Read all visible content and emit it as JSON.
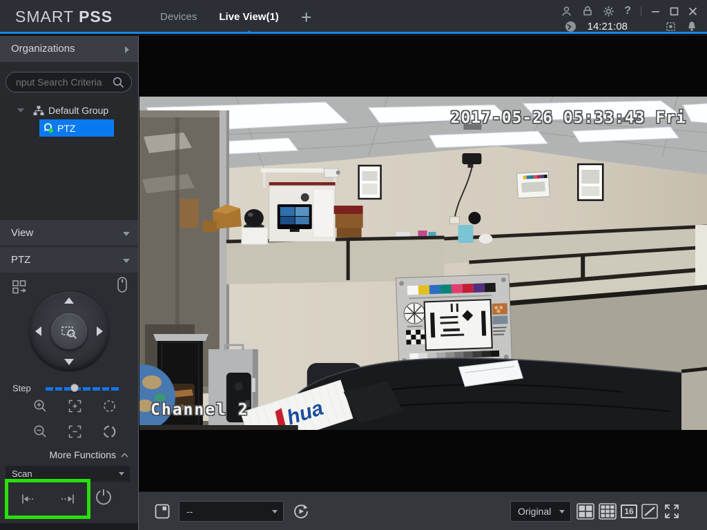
{
  "titlebar": {
    "brand_smart": "SMART",
    "brand_pss": "PSS",
    "tabs": [
      {
        "label": "Devices"
      },
      {
        "label": "Live View(1)"
      }
    ],
    "add_tab_label": "+",
    "help_label": "?",
    "time": "14:21:08"
  },
  "sidebar": {
    "organizations_label": "Organizations",
    "search_placeholder": "nput Search Criteria",
    "tree": {
      "group_label": "Default Group",
      "device_label": "PTZ"
    },
    "view_label": "View",
    "ptz_label": "PTZ",
    "step_label": "Step",
    "more_functions_label": "More Functions",
    "scan_label": "Scan"
  },
  "video": {
    "timestamp": "2017-05-26 05:33:43 Fri",
    "channel_label": "Channel 2",
    "box_logo": "hua"
  },
  "toolbar": {
    "stream_select_value": "--",
    "scale_select_value": "Original",
    "grid_16_label": "16"
  },
  "colors": {
    "accent_blue": "#1787e8",
    "selection_blue": "#0b7af0",
    "annotation_green": "#28e00c",
    "slider_blue": "#1673e6"
  }
}
